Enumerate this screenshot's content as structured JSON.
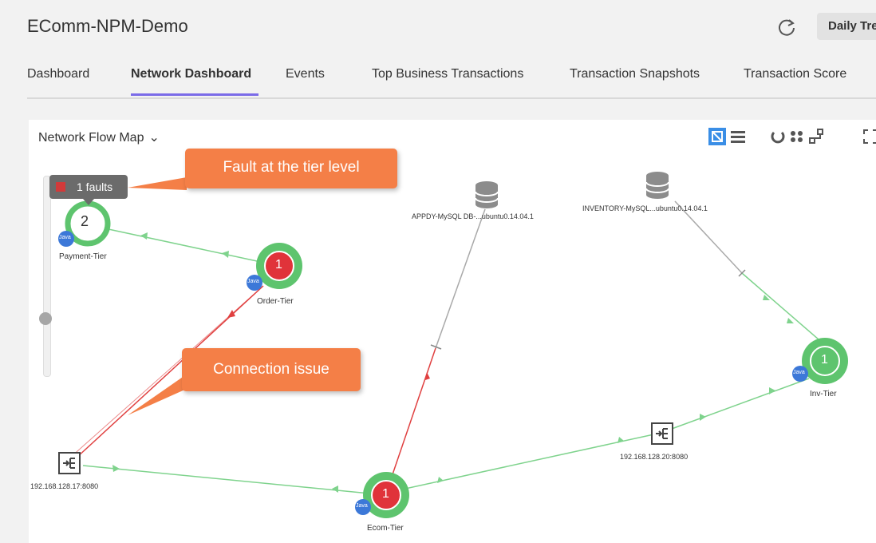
{
  "app": {
    "title": "EComm-NPM-Demo",
    "daily_button": "Daily Tre"
  },
  "icons": {
    "refresh": "refresh-icon"
  },
  "tabs": [
    {
      "label": "Dashboard",
      "active": false
    },
    {
      "label": "Network Dashboard",
      "active": true
    },
    {
      "label": "Events",
      "active": false
    },
    {
      "label": "Top Business Transactions",
      "active": false
    },
    {
      "label": "Transaction Snapshots",
      "active": false
    },
    {
      "label": "Transaction Score",
      "active": false
    }
  ],
  "map": {
    "title": "Network Flow Map",
    "toolbar_icons": [
      "flow-map-view-icon",
      "list-view-icon",
      "auto-arrange-icon",
      "grid-layout-icon",
      "hierarchy-layout-icon",
      "fullscreen-icon"
    ],
    "fault_badge": "1 faults",
    "callouts": {
      "fault": "Fault at the tier level",
      "connection": "Connection issue"
    },
    "nodes": {
      "payment": {
        "label": "Payment-Tier",
        "count": "2",
        "badge": "Java"
      },
      "order": {
        "label": "Order-Tier",
        "count": "1",
        "badge": "Java"
      },
      "ecom": {
        "label": "Ecom-Tier",
        "count": "1",
        "badge": "Java"
      },
      "inv": {
        "label": "Inv-Tier",
        "count": "1",
        "badge": "Java"
      },
      "db1": {
        "label": "APPDY-MySQL DB-...ubuntu0.14.04.1"
      },
      "db2": {
        "label": "INVENTORY-MySQL...ubuntu0.14.04.1"
      },
      "ep1": {
        "label": "192.168.128.17:8080"
      },
      "ep2": {
        "label": "192.168.128.20:8080"
      }
    },
    "colors": {
      "healthy": "#5ec46e",
      "critical": "#e0333a",
      "accent": "#7b6be8",
      "callout": "#f47f47",
      "link_ok": "#7fd38d",
      "link_error": "#e04040",
      "link_unknown": "#a9a9a9"
    }
  }
}
